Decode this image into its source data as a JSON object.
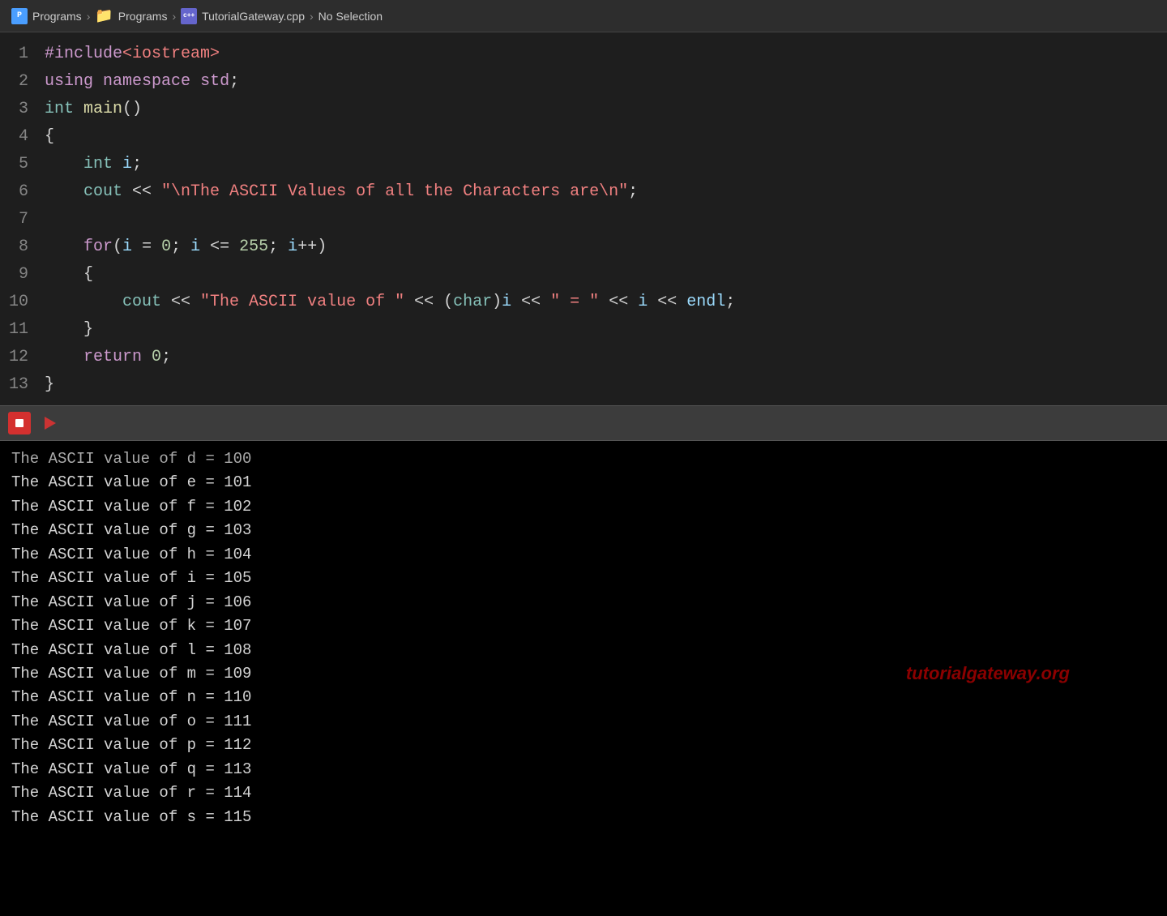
{
  "breadcrumb": {
    "item1": "Programs",
    "sep1": "›",
    "item2": "Programs",
    "sep2": "›",
    "item3": "TutorialGateway.cpp",
    "sep3": "›",
    "item4": "No Selection"
  },
  "editor": {
    "lines": [
      {
        "num": "1",
        "tokens": [
          {
            "text": "#include",
            "cls": "kw-include"
          },
          {
            "text": "<iostream>",
            "cls": "include-lib"
          }
        ]
      },
      {
        "num": "2",
        "tokens": [
          {
            "text": "using",
            "cls": "kw-using"
          },
          {
            "text": " ",
            "cls": ""
          },
          {
            "text": "namespace",
            "cls": "kw-namespace"
          },
          {
            "text": " ",
            "cls": ""
          },
          {
            "text": "std",
            "cls": "kw-std"
          },
          {
            "text": ";",
            "cls": "punct"
          }
        ]
      },
      {
        "num": "3",
        "tokens": [
          {
            "text": "int",
            "cls": "kw-int"
          },
          {
            "text": " ",
            "cls": ""
          },
          {
            "text": "main",
            "cls": "kw-main"
          },
          {
            "text": "()",
            "cls": "punct"
          }
        ]
      },
      {
        "num": "4",
        "tokens": [
          {
            "text": "{",
            "cls": "punct"
          }
        ]
      },
      {
        "num": "5",
        "tokens": [
          {
            "text": "    ",
            "cls": ""
          },
          {
            "text": "int",
            "cls": "kw-int"
          },
          {
            "text": " ",
            "cls": ""
          },
          {
            "text": "i",
            "cls": "var-i"
          },
          {
            "text": ";",
            "cls": "punct"
          }
        ]
      },
      {
        "num": "6",
        "tokens": [
          {
            "text": "    ",
            "cls": ""
          },
          {
            "text": "cout",
            "cls": "kw-cout"
          },
          {
            "text": " << ",
            "cls": "op"
          },
          {
            "text": "\"\\nThe ASCII Values of all the Characters are\\n\"",
            "cls": "str-literal"
          },
          {
            "text": ";",
            "cls": "punct"
          }
        ]
      },
      {
        "num": "7",
        "tokens": []
      },
      {
        "num": "8",
        "tokens": [
          {
            "text": "    ",
            "cls": ""
          },
          {
            "text": "for",
            "cls": "kw-for"
          },
          {
            "text": "(",
            "cls": "punct"
          },
          {
            "text": "i",
            "cls": "var-i"
          },
          {
            "text": " = ",
            "cls": "op"
          },
          {
            "text": "0",
            "cls": "num-literal"
          },
          {
            "text": "; ",
            "cls": "punct"
          },
          {
            "text": "i",
            "cls": "var-i"
          },
          {
            "text": " <= ",
            "cls": "op"
          },
          {
            "text": "255",
            "cls": "num-literal"
          },
          {
            "text": "; ",
            "cls": "punct"
          },
          {
            "text": "i",
            "cls": "var-i"
          },
          {
            "text": "++)",
            "cls": "op"
          }
        ]
      },
      {
        "num": "9",
        "tokens": [
          {
            "text": "    ",
            "cls": ""
          },
          {
            "text": "{",
            "cls": "punct"
          }
        ]
      },
      {
        "num": "10",
        "tokens": [
          {
            "text": "        ",
            "cls": ""
          },
          {
            "text": "cout",
            "cls": "kw-cout"
          },
          {
            "text": " << ",
            "cls": "op"
          },
          {
            "text": "\"The ASCII value of \"",
            "cls": "str-literal"
          },
          {
            "text": " << (",
            "cls": "op"
          },
          {
            "text": "char",
            "cls": "kw-char"
          },
          {
            "text": ")",
            "cls": "punct"
          },
          {
            "text": "i",
            "cls": "var-i"
          },
          {
            "text": " << ",
            "cls": "op"
          },
          {
            "text": "\" = \"",
            "cls": "str-literal"
          },
          {
            "text": " << ",
            "cls": "op"
          },
          {
            "text": "i",
            "cls": "var-i"
          },
          {
            "text": " << ",
            "cls": "op"
          },
          {
            "text": "endl",
            "cls": "endl-kw"
          },
          {
            "text": ";",
            "cls": "punct"
          }
        ]
      },
      {
        "num": "11",
        "tokens": [
          {
            "text": "    ",
            "cls": ""
          },
          {
            "text": "}",
            "cls": "punct"
          }
        ]
      },
      {
        "num": "12",
        "tokens": [
          {
            "text": "    ",
            "cls": ""
          },
          {
            "text": "return",
            "cls": "kw-return"
          },
          {
            "text": " ",
            "cls": ""
          },
          {
            "text": "0",
            "cls": "num-literal"
          },
          {
            "text": ";",
            "cls": "punct"
          }
        ]
      },
      {
        "num": "13",
        "tokens": [
          {
            "text": "}",
            "cls": "punct"
          }
        ]
      }
    ]
  },
  "toolbar": {
    "stop_label": "stop",
    "run_label": "run"
  },
  "terminal": {
    "lines": [
      "The ASCII value of d = 100",
      "The ASCII value of e = 101",
      "The ASCII value of f = 102",
      "The ASCII value of g = 103",
      "The ASCII value of h = 104",
      "The ASCII value of i = 105",
      "The ASCII value of j = 106",
      "The ASCII value of k = 107",
      "The ASCII value of l = 108",
      "The ASCII value of m = 109",
      "The ASCII value of n = 110",
      "The ASCII value of o = 111",
      "The ASCII value of p = 112",
      "The ASCII value of q = 113",
      "The ASCII value of r = 114",
      "The ASCII value of s = 115"
    ],
    "faded_first": "The ASCII value of d = 100",
    "watermark": "tutorialgateway.org"
  }
}
